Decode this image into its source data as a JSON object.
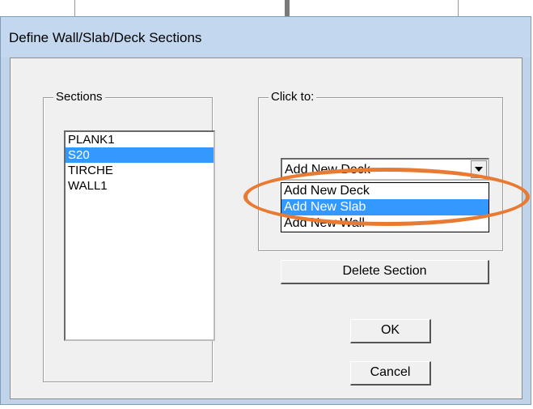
{
  "window": {
    "title": "Define Wall/Slab/Deck Sections"
  },
  "sections": {
    "label": "Sections",
    "items": [
      {
        "label": "PLANK1",
        "selected": false
      },
      {
        "label": "S20",
        "selected": true
      },
      {
        "label": "TIRCHE",
        "selected": false
      },
      {
        "label": "WALL1",
        "selected": false
      }
    ]
  },
  "click_to": {
    "label": "Click to:",
    "combo_value": "Add New Deck",
    "options": [
      {
        "label": "Add New Deck",
        "selected": false
      },
      {
        "label": "Add New Slab",
        "selected": true
      },
      {
        "label": "Add New Wall",
        "selected": false
      }
    ],
    "delete_label": "Delete Section"
  },
  "buttons": {
    "ok": "OK",
    "cancel": "Cancel"
  },
  "colors": {
    "selection": "#3399ff",
    "annotation": "#e97a31"
  }
}
